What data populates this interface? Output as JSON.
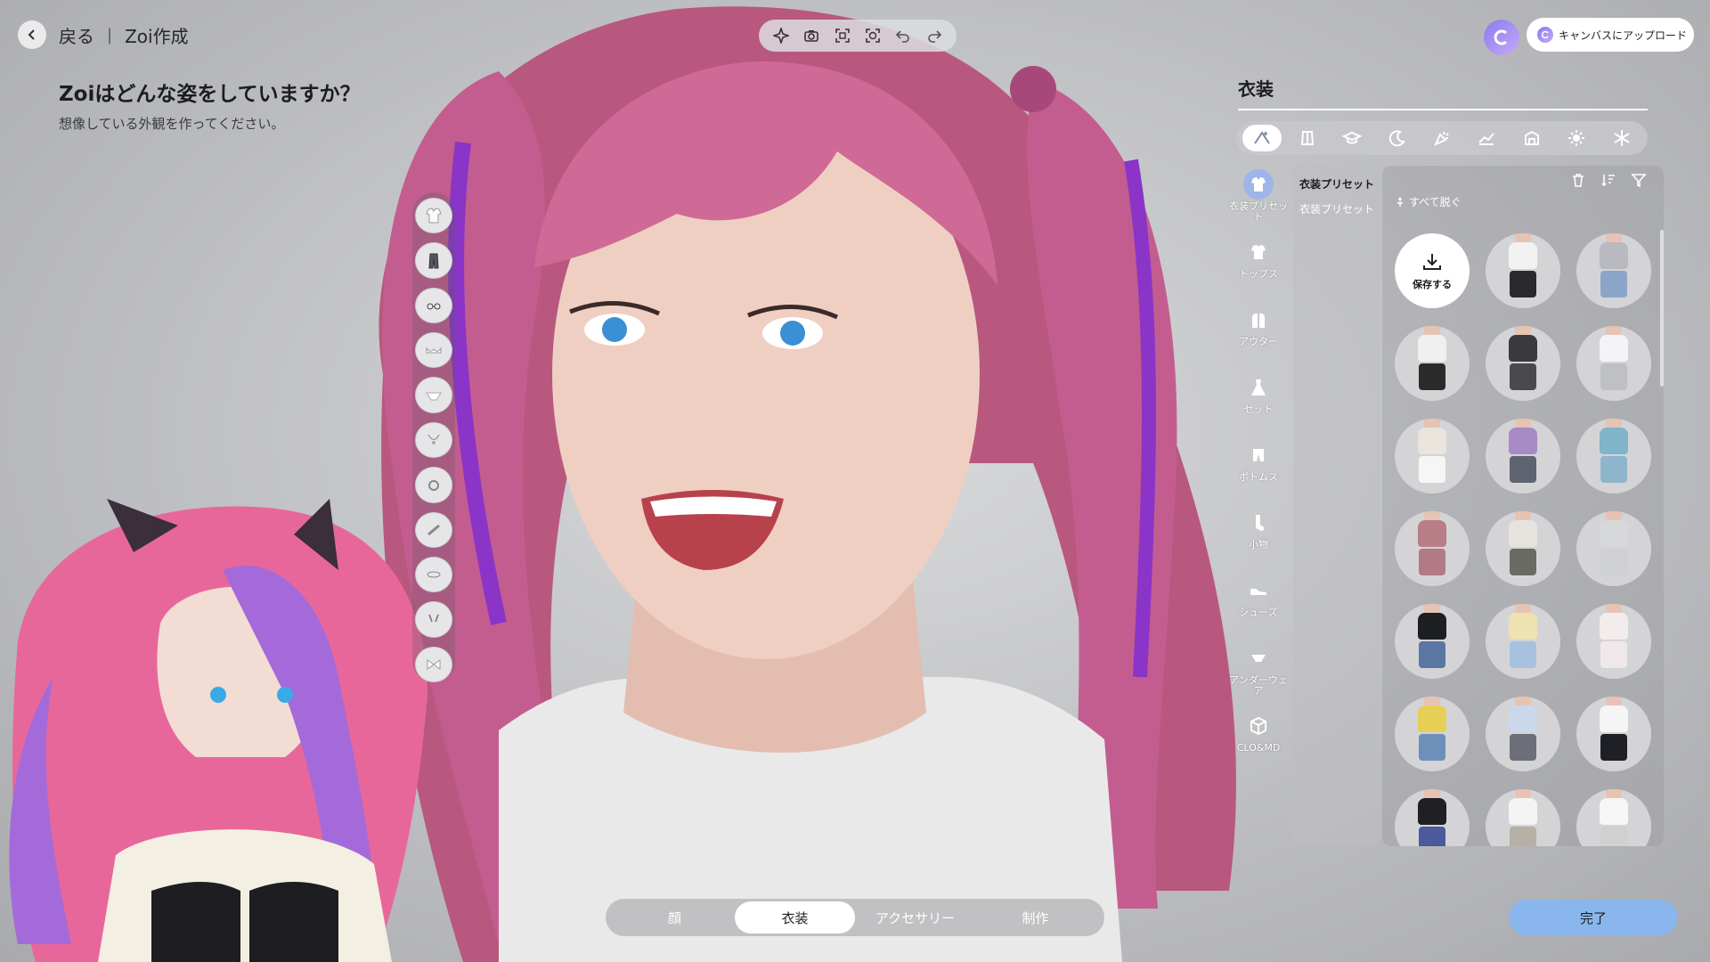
{
  "nav": {
    "back_label": "戻る",
    "separator": "|",
    "title": "Zoi作成"
  },
  "heading": {
    "title": "Zoiはどんな姿をしていますか？",
    "subtitle": "想像している外観を作ってください。"
  },
  "toolbar": {
    "icons": [
      "sparkle-icon",
      "camera-icon",
      "screen-capture-icon",
      "face-capture-icon",
      "undo-icon",
      "redo-icon"
    ]
  },
  "upload": {
    "label": "キャンバスにアップロード",
    "accent": "#8b7bf0"
  },
  "panel": {
    "title": "衣装",
    "category_tabs": [
      "all-icon",
      "formal-icon",
      "school-icon",
      "sleep-icon",
      "party-icon",
      "athletic-icon",
      "outdoor-icon",
      "hot-weather-icon",
      "cold-weather-icon"
    ],
    "side_categories": [
      {
        "label": "衣装プリセット",
        "icon": "preset-icon"
      },
      {
        "label": "トップス",
        "icon": "tshirt-icon"
      },
      {
        "label": "アウター",
        "icon": "jacket-icon"
      },
      {
        "label": "セット",
        "icon": "dress-icon"
      },
      {
        "label": "ボトムス",
        "icon": "pants-icon"
      },
      {
        "label": "小物",
        "icon": "sock-icon"
      },
      {
        "label": "シューズ",
        "icon": "shoe-icon"
      },
      {
        "label": "アンダーウェア",
        "icon": "underwear-icon"
      },
      {
        "label": "CLO&MD",
        "icon": "box-icon"
      }
    ],
    "preset_column": {
      "active": "衣装プリセット",
      "secondary": "衣装プリセット"
    },
    "undress_label": "すべて脱ぐ",
    "save_label": "保存する",
    "items": [
      {
        "top": "#f2f2f2",
        "bottom": "#2a2a2c"
      },
      {
        "top": "#b9b9c0",
        "bottom": "#8aa5c8"
      },
      {
        "top": "#f0f0f0",
        "bottom": "#2c2b2b"
      },
      {
        "top": "#3a3a3e",
        "bottom": "#4a4a4e"
      },
      {
        "top": "#f4f4f6",
        "bottom": "#bfc0c4"
      },
      {
        "top": "#e9e4dc",
        "bottom": "#f6f6f6"
      },
      {
        "top": "#a88ac4",
        "bottom": "#5e6470"
      },
      {
        "top": "#7fb4c9",
        "bottom": "#8fb5cd"
      },
      {
        "top": "#b87d86",
        "bottom": "#b27a84"
      },
      {
        "top": "#e6e3de",
        "bottom": "#6a6c64"
      },
      {
        "top": "#d7d8dc",
        "bottom": "#cfd0d4"
      },
      {
        "top": "#1e1f22",
        "bottom": "#5a77a3"
      },
      {
        "top": "#efe2b2",
        "bottom": "#a7c2df"
      },
      {
        "top": "#f3ecec",
        "bottom": "#f0e8e8"
      },
      {
        "top": "#e7cf55",
        "bottom": "#6d8fba"
      },
      {
        "top": "#c9d8ea",
        "bottom": "#6d6f78"
      },
      {
        "top": "#f5f5f5",
        "bottom": "#1f2026"
      },
      {
        "top": "#202024",
        "bottom": "#4a5a9a"
      },
      {
        "top": "#f4f4f4",
        "bottom": "#b6b0a6"
      },
      {
        "top": "#f6f6f6",
        "bottom": "#d0d0d0"
      }
    ]
  },
  "bottom_tabs": [
    "顔",
    "衣装",
    "アクセサリー",
    "制作"
  ],
  "active_bottom_tab": "衣装",
  "done_label": "完了"
}
